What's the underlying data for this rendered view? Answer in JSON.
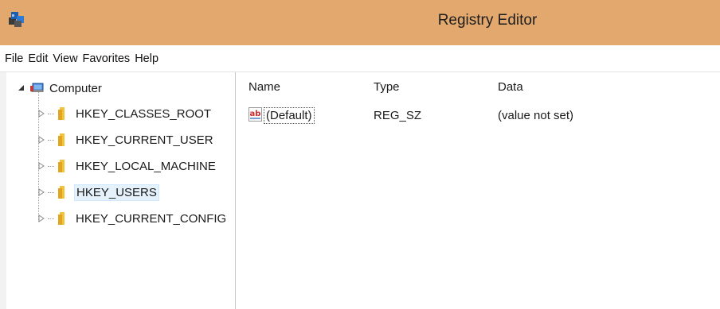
{
  "window": {
    "title": "Registry Editor"
  },
  "menu": [
    "File",
    "Edit",
    "View",
    "Favorites",
    "Help"
  ],
  "tree": {
    "root": "Computer",
    "keys": [
      {
        "label": "HKEY_CLASSES_ROOT",
        "selected": false
      },
      {
        "label": "HKEY_CURRENT_USER",
        "selected": false
      },
      {
        "label": "HKEY_LOCAL_MACHINE",
        "selected": false
      },
      {
        "label": "HKEY_USERS",
        "selected": true
      },
      {
        "label": "HKEY_CURRENT_CONFIG",
        "selected": false
      }
    ]
  },
  "list": {
    "columns": [
      "Name",
      "Type",
      "Data"
    ],
    "rows": [
      {
        "name": "(Default)",
        "type": "REG_SZ",
        "data": "(value not set)",
        "icon": "string-value-icon"
      }
    ]
  },
  "colors": {
    "titlebar": "#e3a86d",
    "selection": "#e5f1fb",
    "folder": "#f2c23c"
  }
}
